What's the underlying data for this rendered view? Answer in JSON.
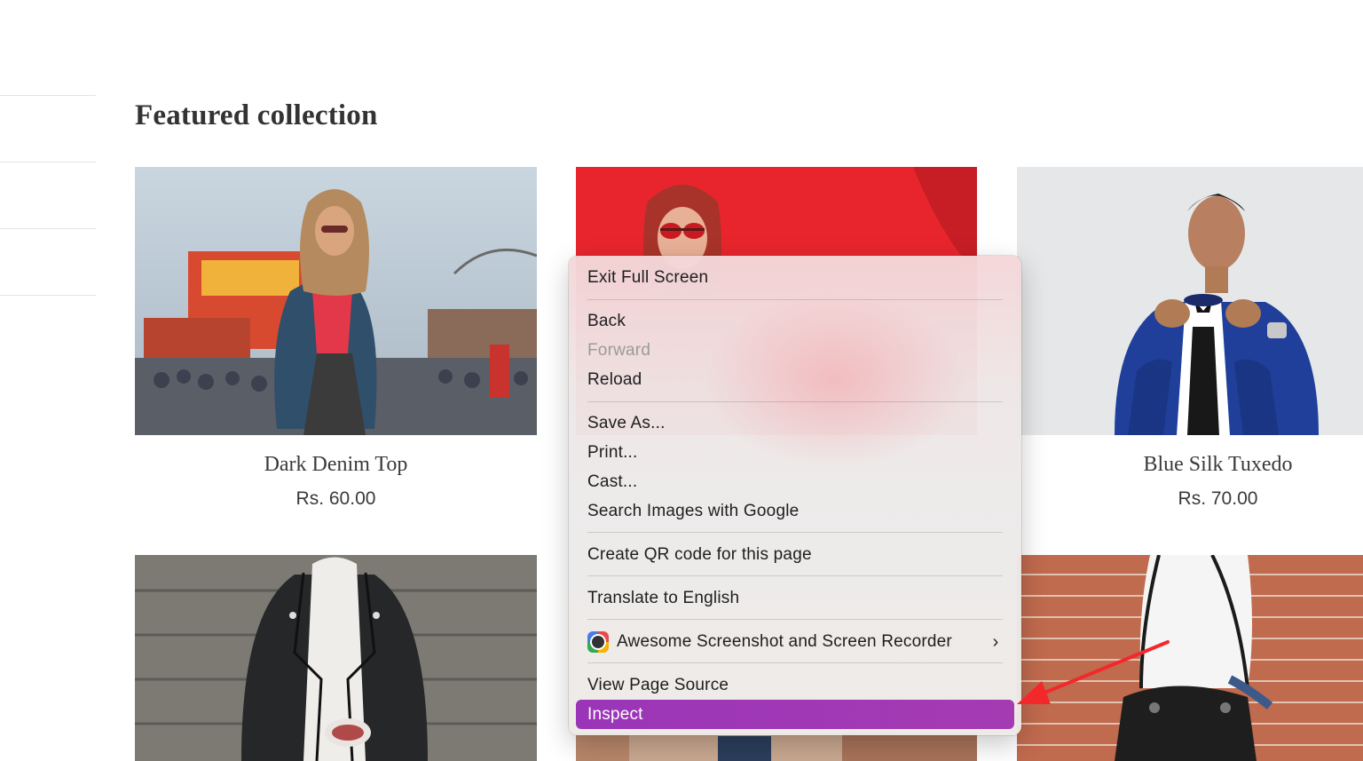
{
  "page": {
    "section_title": "Featured collection"
  },
  "products": [
    {
      "name": "Dark Denim Top",
      "price": "Rs. 60.00"
    },
    {
      "name": "Blue Silk Tuxedo",
      "price": "Rs. 70.00"
    }
  ],
  "context_menu": {
    "exit_full_screen": "Exit Full Screen",
    "back": "Back",
    "forward": "Forward",
    "reload": "Reload",
    "save_as": "Save As...",
    "print": "Print...",
    "cast": "Cast...",
    "search_images": "Search Images with Google",
    "create_qr": "Create QR code for this page",
    "translate": "Translate to English",
    "extension": "Awesome Screenshot and Screen Recorder",
    "view_source": "View Page Source",
    "inspect": "Inspect",
    "extension_icon": "awesome-screenshot-icon",
    "submenu_icon": "chevron-right-icon",
    "highlight_color": "#A23AB5"
  },
  "annotation": {
    "arrow_color": "#F2282B"
  }
}
